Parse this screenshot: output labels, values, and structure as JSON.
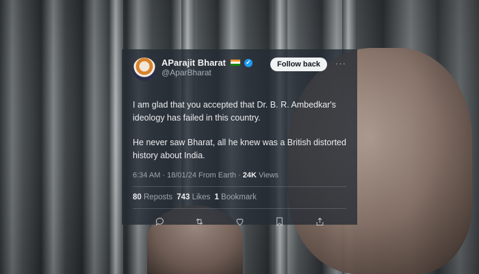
{
  "tweet": {
    "display_name": "AParajit Bharat",
    "handle": "@AparBharat",
    "follow_label": "Follow back",
    "more_label": "···",
    "text": [
      "I am glad that you accepted that Dr. B. R. Ambedkar's ideology has failed in this country.",
      "He never saw Bharat, all he knew was a British distorted history about India."
    ],
    "time": "6:34 AM · 18/01/24 From Earth · ",
    "views_count": "24K",
    "views_label": " Views",
    "reposts_count": "80",
    "reposts_label": "Reposts",
    "likes_count": "743",
    "likes_label": "Likes",
    "bookmarks_count": "1",
    "bookmarks_label": "Bookmark"
  },
  "icons": {
    "flag": "india-flag-icon",
    "verified": "verified-badge-icon",
    "reply": "reply-icon",
    "repost": "repost-icon",
    "like": "heart-icon",
    "bookmark": "bookmark-icon",
    "share": "share-icon"
  },
  "colors": {
    "verified": "#1d9bf0",
    "card_bg": "#262c34"
  }
}
